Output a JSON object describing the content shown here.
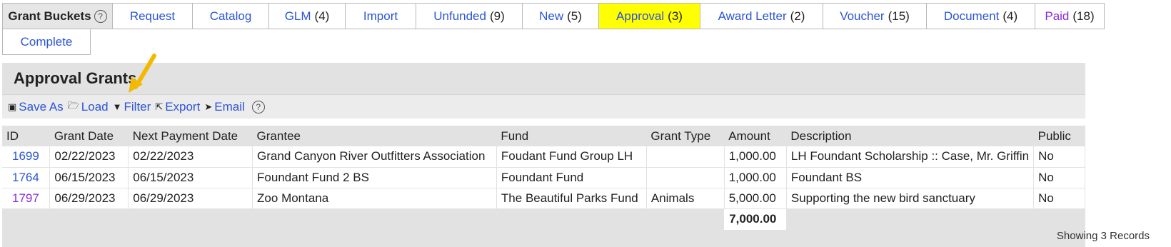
{
  "tabs": {
    "label": "Grant Buckets",
    "help": "?",
    "row1": [
      {
        "label": "Request",
        "count": ""
      },
      {
        "label": "Catalog",
        "count": ""
      },
      {
        "label": "GLM",
        "count": "(4)"
      },
      {
        "label": "Import",
        "count": ""
      },
      {
        "label": "Unfunded",
        "count": "(9)"
      },
      {
        "label": "New",
        "count": "(5)"
      },
      {
        "label": "Approval",
        "count": "(3)"
      },
      {
        "label": "Award Letter",
        "count": "(2)"
      },
      {
        "label": "Voucher",
        "count": "(15)"
      },
      {
        "label": "Document",
        "count": "(4)"
      },
      {
        "label": "Paid",
        "count": "(18)"
      }
    ],
    "row2": [
      {
        "label": "Complete",
        "count": ""
      }
    ]
  },
  "panel": {
    "title": "Approval Grants"
  },
  "toolbar": {
    "save_as": "Save As",
    "load": "Load",
    "filter": "Filter",
    "export": "Export",
    "email": "Email",
    "help": "?"
  },
  "table": {
    "headers": [
      "ID",
      "Grant Date",
      "Next Payment Date",
      "Grantee",
      "Fund",
      "Grant Type",
      "Amount",
      "Description",
      "Public"
    ],
    "rows": [
      {
        "id": "1699",
        "grant_date": "02/22/2023",
        "next_payment": "02/22/2023",
        "grantee": "Grand Canyon River Outfitters Association",
        "fund": "Foudant Fund Group LH",
        "type": "",
        "amount": "1,000.00",
        "description": "LH Foundant Scholarship :: Case, Mr. Griffin",
        "public": "No"
      },
      {
        "id": "1764",
        "grant_date": "06/15/2023",
        "next_payment": "06/15/2023",
        "grantee": "Foundant Fund 2 BS",
        "fund": "Foundant Fund",
        "type": "",
        "amount": "1,000.00",
        "description": "Foundant BS",
        "public": "No"
      },
      {
        "id": "1797",
        "grant_date": "06/29/2023",
        "next_payment": "06/29/2023",
        "grantee": "Zoo Montana",
        "fund": "The Beautiful Parks Fund",
        "type": "Animals",
        "amount": "5,000.00",
        "description": "Supporting the new bird sanctuary",
        "public": "No"
      }
    ],
    "total": "7,000.00"
  },
  "footer": {
    "text": "Showing 3 Records"
  },
  "colors": {
    "link": "#2b55d6",
    "visited": "#8a2be2",
    "active_tab": "#ffff00",
    "arrow": "#f5b800"
  }
}
